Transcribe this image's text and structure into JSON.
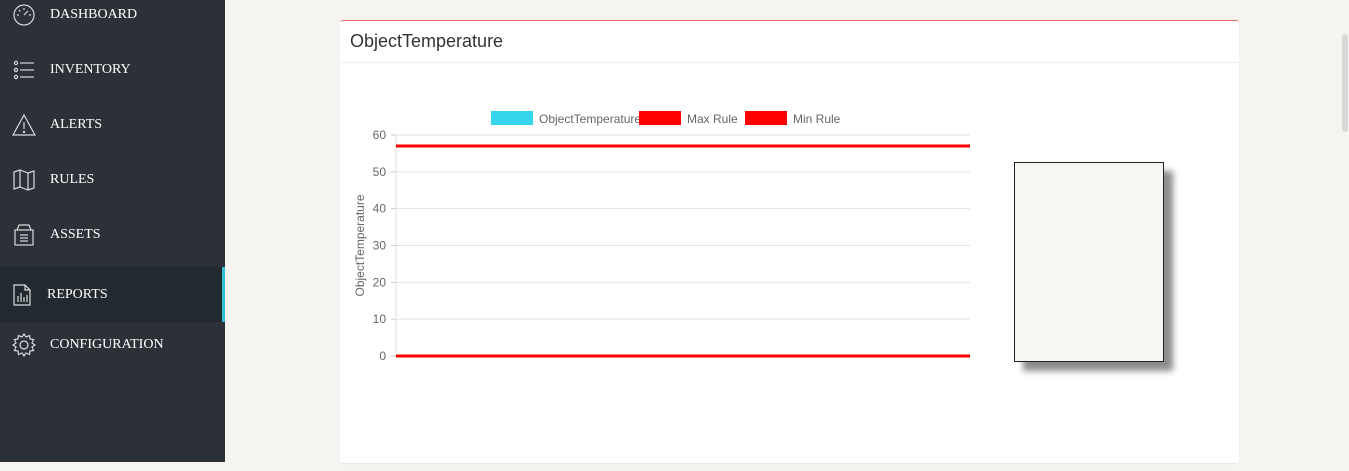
{
  "sidebar": {
    "items": [
      {
        "label": "DASHBOARD",
        "icon": "speedometer-icon",
        "active": false
      },
      {
        "label": "INVENTORY",
        "icon": "list-icon",
        "active": false
      },
      {
        "label": "ALERTS",
        "icon": "warning-triangle-icon",
        "active": false
      },
      {
        "label": "RULES",
        "icon": "map-book-icon",
        "active": false
      },
      {
        "label": "ASSETS",
        "icon": "archive-box-icon",
        "active": false
      },
      {
        "label": "REPORTS",
        "icon": "report-chart-icon",
        "active": true
      },
      {
        "label": "CONFIGURATION",
        "icon": "gear-icon",
        "active": false
      }
    ],
    "active_color": "#2fc0d6",
    "background": "#2b3137"
  },
  "panel": {
    "title": "ObjectTemperature",
    "border_color": "#e36a63"
  },
  "chart_data": {
    "type": "line",
    "ylabel": "ObjectTemperature",
    "xlabel": "",
    "ylim": [
      0,
      60
    ],
    "yticks": [
      "0",
      "10",
      "20",
      "30",
      "40",
      "50",
      "60"
    ],
    "grid": true,
    "legend_position": "top-center",
    "series": [
      {
        "name": "ObjectTemperature",
        "color": "#36d7ee",
        "values": []
      },
      {
        "name": "Max Rule",
        "color": "#ff0000",
        "constant": 57
      },
      {
        "name": "Min Rule",
        "color": "#ff0000",
        "constant": 0
      }
    ]
  }
}
